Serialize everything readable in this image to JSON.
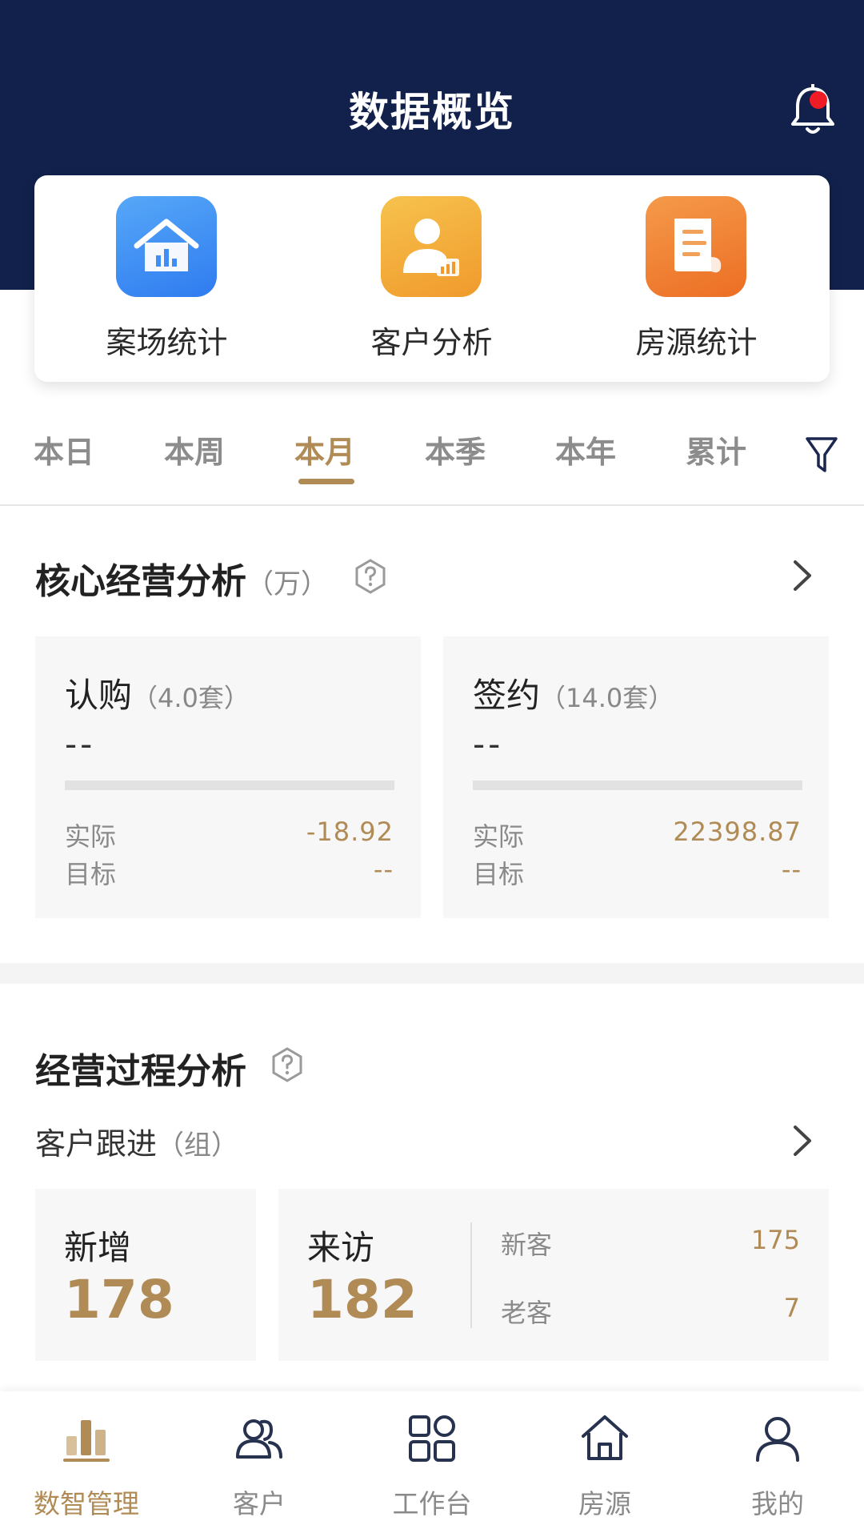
{
  "header": {
    "title": "数据概览",
    "bell_icon": "bell-icon",
    "has_notification": true
  },
  "quick": [
    {
      "label": "案场统计",
      "icon": "house-chart-icon",
      "color": "#3f8ef5"
    },
    {
      "label": "客户分析",
      "icon": "person-chart-icon",
      "color": "#f2a93b"
    },
    {
      "label": "房源统计",
      "icon": "document-icon",
      "color": "#ef7e2e"
    }
  ],
  "tabs": [
    "本日",
    "本周",
    "本月",
    "本季",
    "本年",
    "累计"
  ],
  "active_tab": "本月",
  "core": {
    "title": "核心经营分析",
    "unit": "（万）",
    "cards": [
      {
        "name": "认购",
        "count": "（4.0套）",
        "main": "--",
        "actual_label": "实际",
        "actual": "-18.92",
        "target_label": "目标",
        "target": "--"
      },
      {
        "name": "签约",
        "count": "（14.0套）",
        "main": "--",
        "actual_label": "实际",
        "actual": "22398.87",
        "target_label": "目标",
        "target": "--"
      }
    ]
  },
  "process": {
    "title": "经营过程分析",
    "follow_label": "客户跟进",
    "follow_unit": "（组）",
    "new": {
      "name": "新增",
      "value": "178"
    },
    "visit": {
      "name": "来访",
      "value": "182",
      "new_label": "新客",
      "new_value": "175",
      "old_label": "老客",
      "old_value": "7"
    }
  },
  "nav": [
    {
      "label": "数智管理",
      "icon": "bar-chart-icon",
      "active": true
    },
    {
      "label": "客户",
      "icon": "users-icon",
      "active": false
    },
    {
      "label": "工作台",
      "icon": "grid-icon",
      "active": false
    },
    {
      "label": "房源",
      "icon": "home-icon",
      "active": false
    },
    {
      "label": "我的",
      "icon": "profile-icon",
      "active": false
    }
  ],
  "colors": {
    "header": "#12214b",
    "accent": "#b08b55",
    "alert": "#ef1c25"
  }
}
